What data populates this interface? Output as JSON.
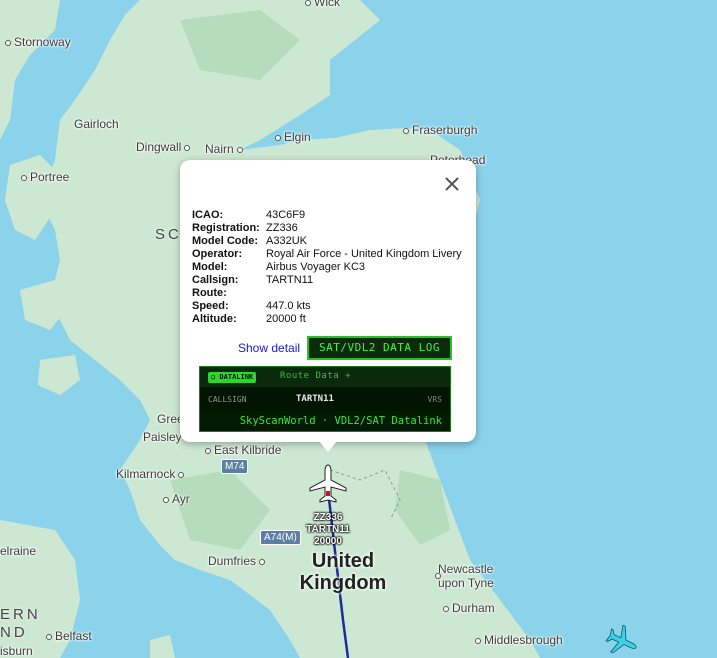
{
  "map": {
    "places": [
      {
        "id": "wick",
        "name": "Wick"
      },
      {
        "id": "stornoway",
        "name": "Stornoway"
      },
      {
        "id": "gairloch",
        "name": "Gairloch"
      },
      {
        "id": "dingwall",
        "name": "Dingwall"
      },
      {
        "id": "nairn",
        "name": "Nairn"
      },
      {
        "id": "elgin",
        "name": "Elgin"
      },
      {
        "id": "fraserburgh",
        "name": "Fraserburgh"
      },
      {
        "id": "peterhead",
        "name": "Peterhead"
      },
      {
        "id": "portree",
        "name": "Portree"
      },
      {
        "id": "greenock",
        "name": "Gree"
      },
      {
        "id": "paisley",
        "name": "Paisley"
      },
      {
        "id": "east-kilbride",
        "name": "East Kilbride"
      },
      {
        "id": "kilmarnock",
        "name": "Kilmarnock"
      },
      {
        "id": "ayr",
        "name": "Ayr"
      },
      {
        "id": "dumfries",
        "name": "Dumfries"
      },
      {
        "id": "newcastle",
        "name": "Newcastle upon Tyne"
      },
      {
        "id": "durham",
        "name": "Durham"
      },
      {
        "id": "middlesbrough",
        "name": "Middlesbrough"
      },
      {
        "id": "belfast",
        "name": "Belfast"
      },
      {
        "id": "lisburn",
        "name": "isburn"
      },
      {
        "id": "larne",
        "name": "elraine"
      }
    ],
    "regions": {
      "uk_line1": "United",
      "uk_line2": "Kingdom",
      "scotland_fragment": "SC",
      "ni_fragment_1": "ERN",
      "ni_fragment_2": "ND"
    },
    "roads": {
      "m74": "M74",
      "a74m": "A74(M)"
    },
    "colors": {
      "water": "#8bd3ea",
      "land": "#cde8d2",
      "land_green": "#b5dcbc",
      "track": "#1c2a9c"
    }
  },
  "aircraft": {
    "selected": {
      "reg": "ZZ336",
      "callsign": "TARTN11",
      "altitude": "20000"
    }
  },
  "popup": {
    "fields": [
      {
        "key": "ICAO:",
        "value": "43C6F9"
      },
      {
        "key": "Registration:",
        "value": "ZZ336"
      },
      {
        "key": "Model Code:",
        "value": "A332UK"
      },
      {
        "key": "Operator:",
        "value": "Royal Air Force - United Kingdom Livery"
      },
      {
        "key": "Model:",
        "value": "Airbus Voyager KC3"
      },
      {
        "key": "Callsign:",
        "value": "TARTN11"
      },
      {
        "key": "Route:",
        "value": ""
      },
      {
        "key": "Speed:",
        "value": "447.0 kts"
      },
      {
        "key": "Altitude:",
        "value": "20000 ft"
      }
    ],
    "show_detail": "Show detail",
    "log_button": "SAT/VDL2 DATA LOG",
    "close_icon": "close-icon",
    "datalink": {
      "badge": "○ DATALINK",
      "route_data": "Route Data ✈",
      "callsign_label": "CALLSIGN",
      "callsign_value": "TARTN11",
      "source": "VRS",
      "footer": "SkyScanWorld · VDL2/SAT Datalink"
    }
  }
}
